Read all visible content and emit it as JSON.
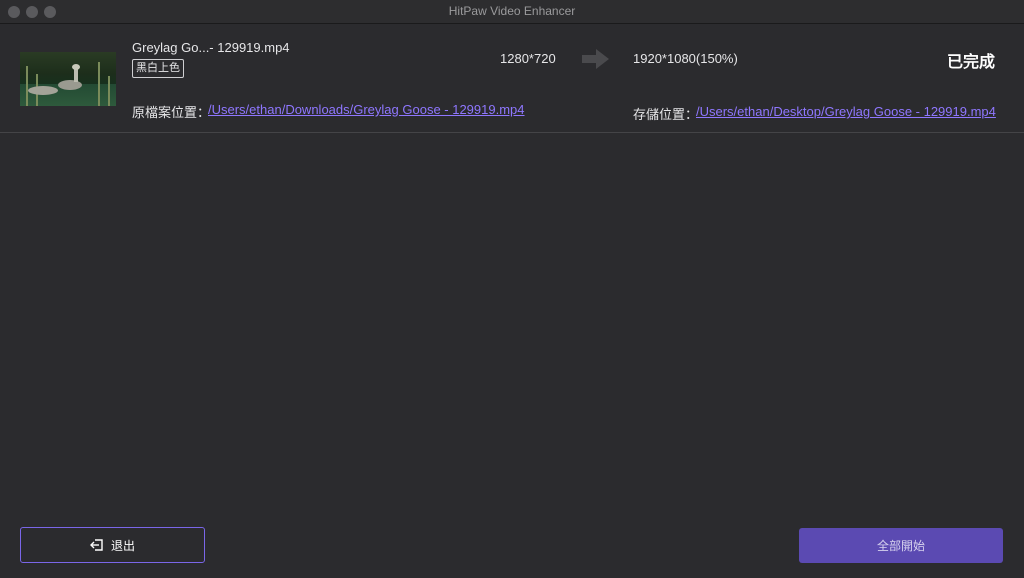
{
  "window": {
    "title": "HitPaw Video Enhancer"
  },
  "task": {
    "file_name": "Greylag Go...- 129919.mp4",
    "model_tag": "黑白上色",
    "resolution_from": "1280*720",
    "resolution_to": "1920*1080(150%)",
    "status": "已完成",
    "source_label": "原檔案位置：",
    "source_path": "/Users/ethan/Downloads/Greylag Goose - 129919.mp4",
    "save_label": "存儲位置：",
    "save_path": "/Users/ethan/Desktop/Greylag Goose - 129919.mp4"
  },
  "footer": {
    "exit_label": "退出",
    "start_all_label": "全部開始"
  },
  "colors": {
    "background": "#2b2b2e",
    "link": "#8f77ff",
    "accent": "#5b4ab2",
    "accent_border": "#7a66e8"
  }
}
